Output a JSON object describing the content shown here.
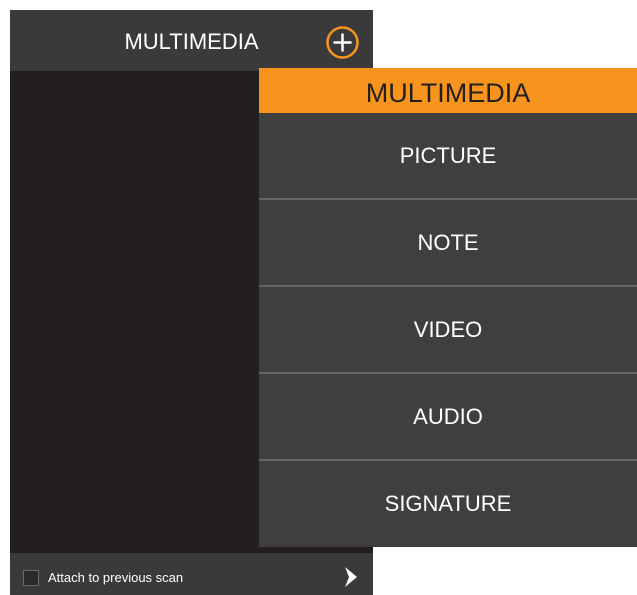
{
  "app": {
    "title": "MULTIMEDIA"
  },
  "header": {
    "add_icon": "plus-circle-icon"
  },
  "footer": {
    "attach_label": "Attach to previous scan",
    "attach_checked": false,
    "next_icon": "chevron-right-icon"
  },
  "dropdown": {
    "title": "MULTIMEDIA",
    "items": [
      {
        "label": "PICTURE"
      },
      {
        "label": "NOTE"
      },
      {
        "label": "VIDEO"
      },
      {
        "label": "AUDIO"
      },
      {
        "label": "SIGNATURE"
      }
    ]
  },
  "colors": {
    "accent": "#f7941d",
    "header_bg": "#3a3a3a",
    "body_bg": "#231f20",
    "menu_bg": "#3f3f3f",
    "divider": "#666666"
  }
}
